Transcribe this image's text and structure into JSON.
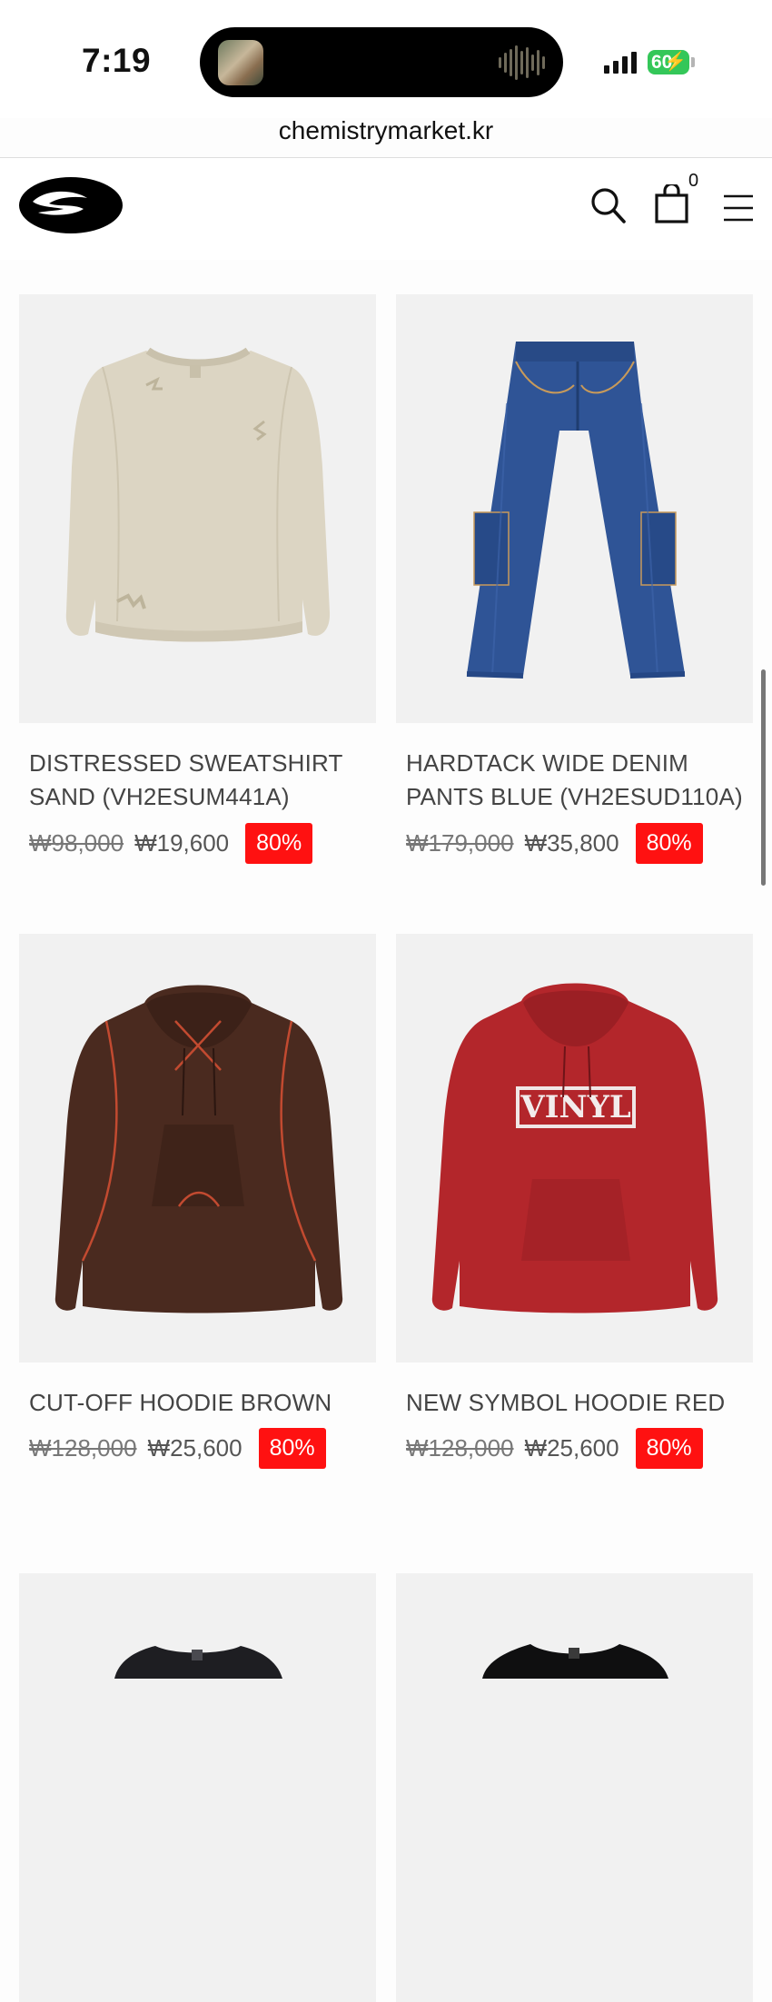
{
  "status": {
    "time": "7:19",
    "battery": "60"
  },
  "browser": {
    "url": "chemistrymarket.kr"
  },
  "header": {
    "cart_count": "0"
  },
  "products": [
    {
      "name": "DISTRESSED SWEATSHIRT SAND (VH2ESUM441A)",
      "old_price": "₩98,000",
      "price": "₩19,600",
      "discount": "80%",
      "icon": "sweatshirt-sand"
    },
    {
      "name": "HARDTACK WIDE DENIM PANTS BLUE (VH2ESUD110A)",
      "old_price": "₩179,000",
      "price": "₩35,800",
      "discount": "80%",
      "icon": "denim-pants-blue"
    },
    {
      "name": "CUT-OFF HOODIE BROWN",
      "old_price": "₩128,000",
      "price": "₩25,600",
      "discount": "80%",
      "icon": "hoodie-brown"
    },
    {
      "name": "NEW SYMBOL HOODIE RED",
      "old_price": "₩128,000",
      "price": "₩25,600",
      "discount": "80%",
      "icon": "hoodie-red",
      "print": "VINYL"
    }
  ]
}
